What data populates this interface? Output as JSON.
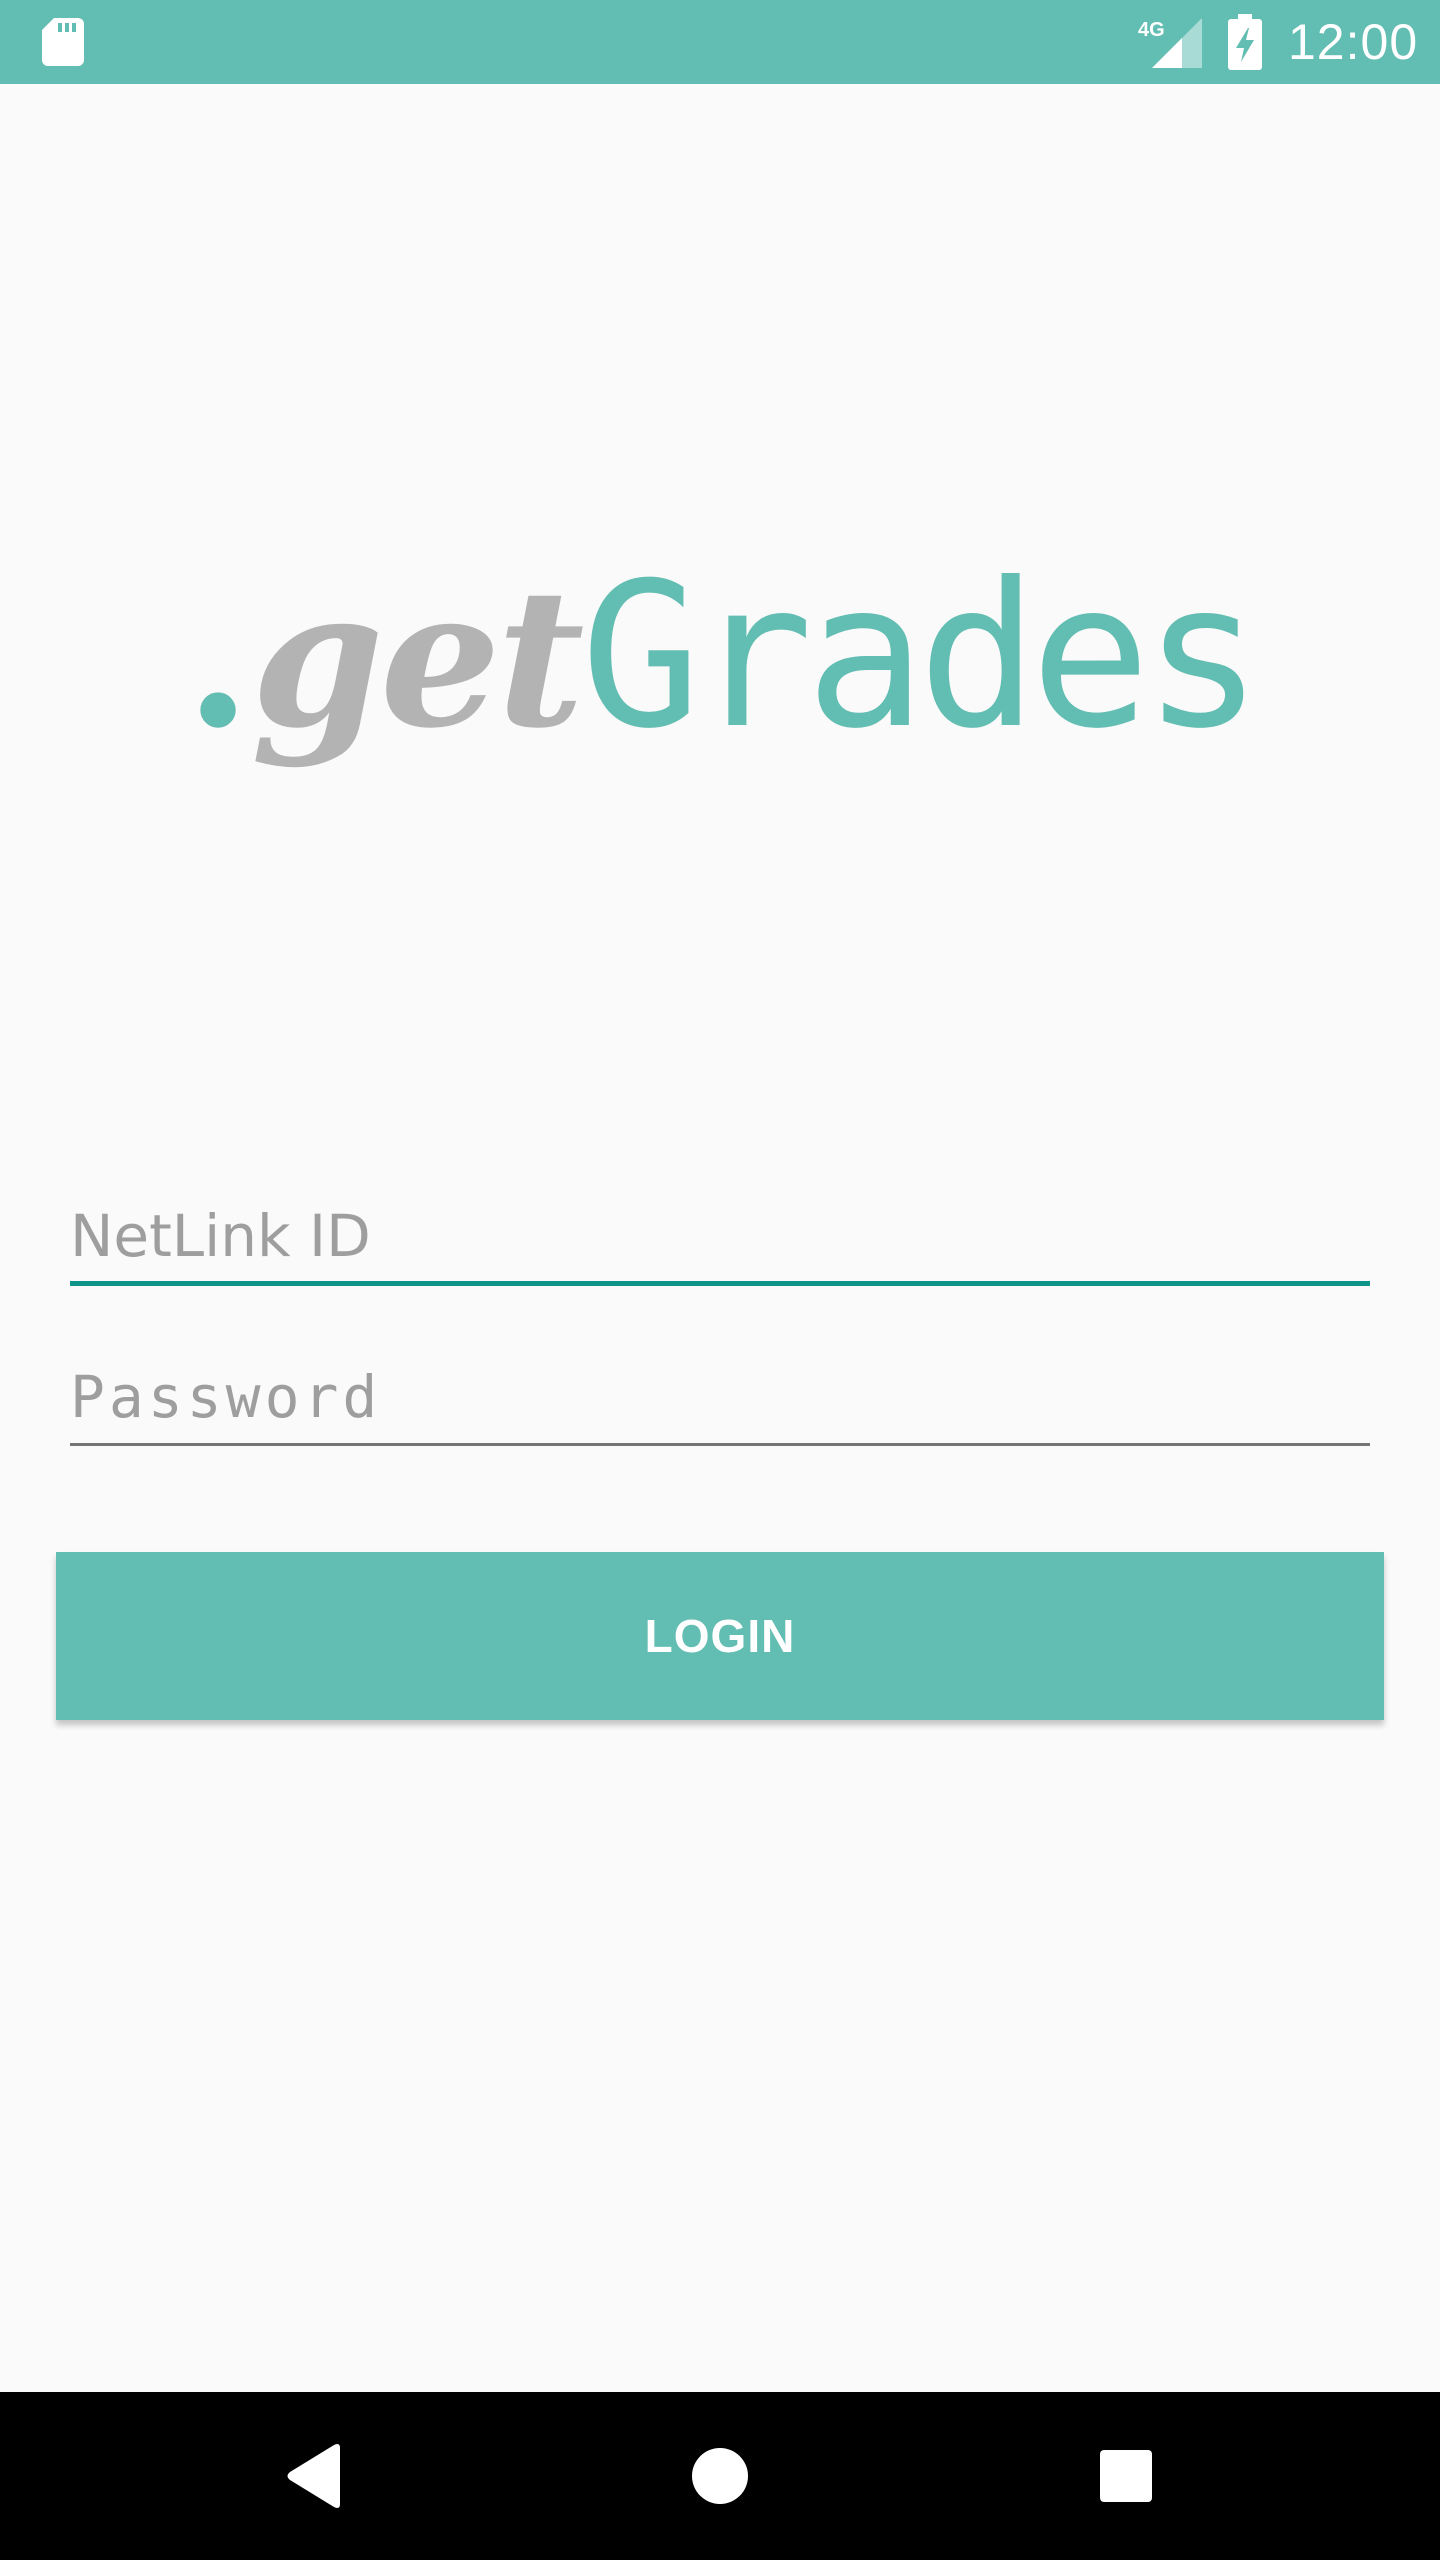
{
  "status_bar": {
    "network": "4G",
    "time": "12:00",
    "icons": [
      "sd-card-icon",
      "signal-icon",
      "battery-charging-icon"
    ]
  },
  "logo": {
    "dot": ".",
    "get": "get",
    "grades": "Grades"
  },
  "form": {
    "netlink_placeholder": "NetLink ID",
    "password_placeholder": "Password",
    "login_label": "LOGIN"
  },
  "colors": {
    "primary": "#62bdb2",
    "accent": "#0f9489",
    "logo_gray": "#b3b3b3",
    "background": "#fafafa"
  },
  "nav_bar": {
    "icons": [
      "back-icon",
      "home-icon",
      "recents-icon"
    ]
  }
}
